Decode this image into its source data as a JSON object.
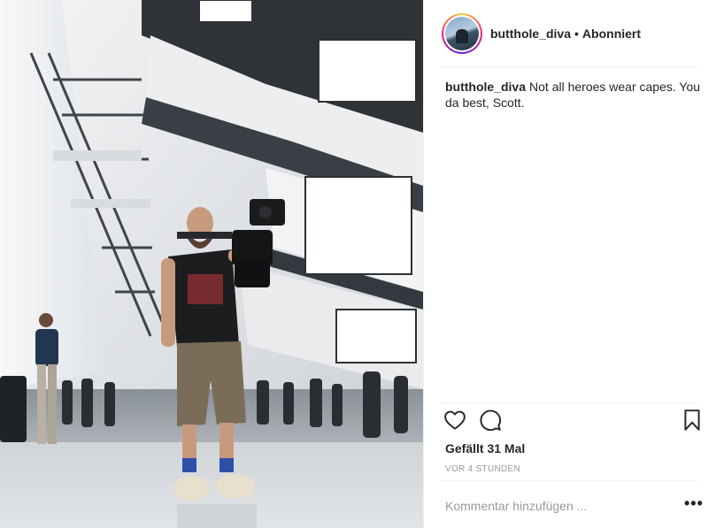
{
  "post": {
    "username": "butthole_diva",
    "separator": "•",
    "follow_status": "Abonniert",
    "caption": {
      "username": "butthole_diva",
      "text": "Not all heroes wear capes. You da best, Scott."
    },
    "likes_text": "Gefällt 31 Mal",
    "timestamp": "VOR 4 STUNDEN",
    "comment_placeholder": "Kommentar hinzufügen ...",
    "more_label": "•••"
  },
  "icons": {
    "like": "heart-icon",
    "comment": "comment-bubble-icon",
    "save": "bookmark-icon",
    "more": "more-options-icon"
  },
  "colors": {
    "text": "#262626",
    "muted": "#999999",
    "divider": "#efefef"
  }
}
